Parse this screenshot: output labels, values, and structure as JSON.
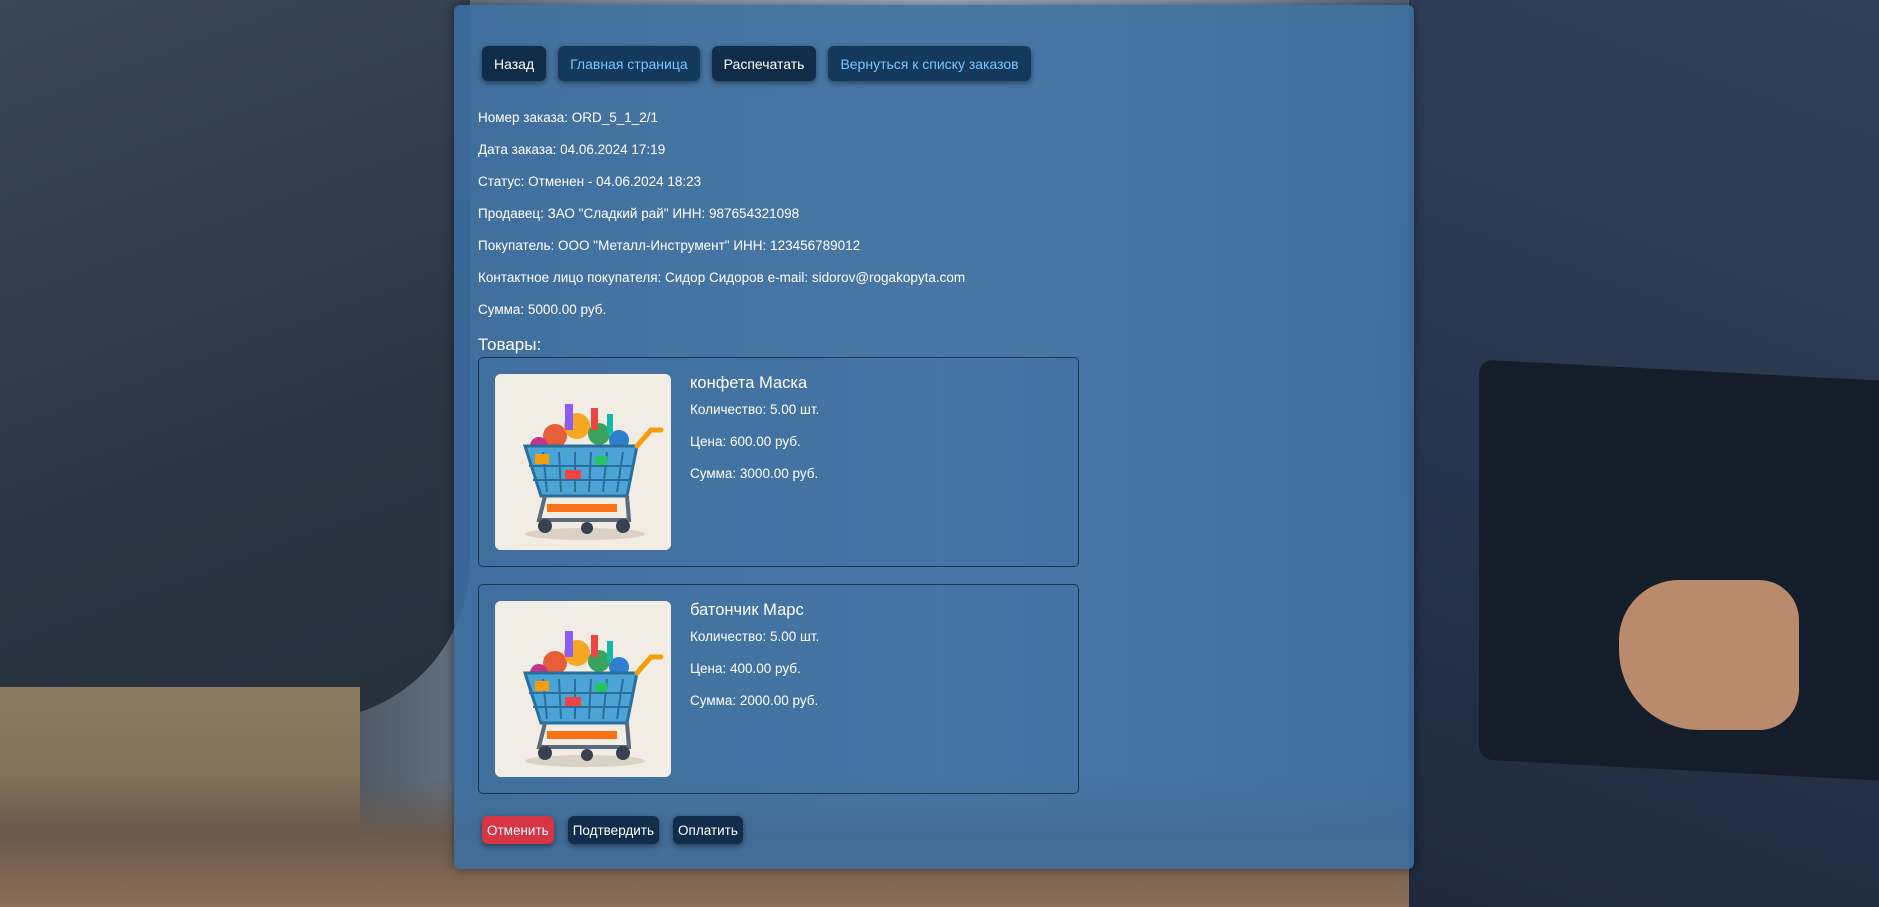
{
  "nav": {
    "back": "Назад",
    "home": "Главная страница",
    "print": "Распечатать",
    "orders": "Вернуться к списку заказов"
  },
  "order": {
    "number": "Номер заказа: ORD_5_1_2/1",
    "date": "Дата заказа: 04.06.2024 17:19",
    "status": "Статус: Отменен - 04.06.2024 18:23",
    "seller": "Продавец: ЗАО \"Сладкий рай\" ИНН: 987654321098",
    "buyer": "Покупатель: ООО \"Металл-Инструмент\" ИНН: 123456789012",
    "contact": "Контактное лицо покупателя: Сидор Сидоров e-mail: sidorov@rogakopyta.com",
    "total": "Сумма: 5000.00 руб."
  },
  "goods": {
    "title": "Товары:",
    "items": [
      {
        "name": "конфета Маска",
        "quantity": "Количество: 5.00 шт.",
        "price": "Цена: 600.00 руб.",
        "sum": "Сумма: 3000.00 руб.",
        "image_icon": "shopping-cart-icon"
      },
      {
        "name": "батончик Марс",
        "quantity": "Количество: 5.00 шт.",
        "price": "Цена: 400.00 руб.",
        "sum": "Сумма: 2000.00 руб.",
        "image_icon": "shopping-cart-icon"
      }
    ]
  },
  "actions": {
    "cancel": "Отменить",
    "confirm": "Подтвердить",
    "pay": "Оплатить"
  },
  "colors": {
    "panel": "#3c6ea0",
    "nav_dark": "#0f2c48",
    "link_text": "#7cc4ff",
    "danger": "#d63545"
  }
}
